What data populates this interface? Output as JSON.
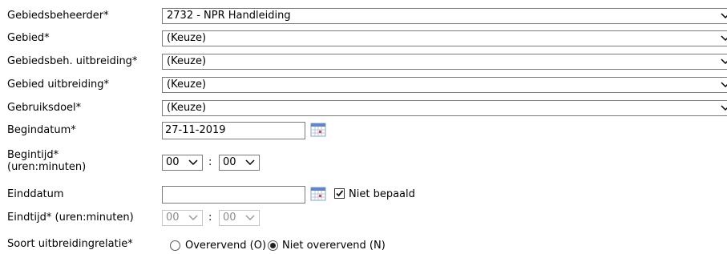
{
  "form": {
    "gebiedsbeheerder": {
      "label": "Gebiedsbeheerder*",
      "value": "2732 - NPR Handleiding"
    },
    "gebied": {
      "label": "Gebied*",
      "value": "(Keuze)"
    },
    "gebiedsbeh_uitbreiding": {
      "label": "Gebiedsbeh. uitbreiding*",
      "value": "(Keuze)"
    },
    "gebied_uitbreiding": {
      "label": "Gebied uitbreiding*",
      "value": "(Keuze)"
    },
    "gebruiksdoel": {
      "label": "Gebruiksdoel*",
      "value": "(Keuze)"
    },
    "begindatum": {
      "label": "Begindatum*",
      "value": "27-11-2019"
    },
    "begintijd": {
      "label_line1": "Begintijd*",
      "label_line2": "(uren:minuten)",
      "hours": "00",
      "minutes": "00",
      "separator": ":"
    },
    "einddatum": {
      "label": "Einddatum",
      "value": "",
      "niet_bepaald_label": "Niet bepaald",
      "niet_bepaald_checked": true
    },
    "eindtijd": {
      "label": "Eindtijd* (uren:minuten)",
      "hours": "00",
      "minutes": "00",
      "separator": ":",
      "disabled": true
    },
    "soort_uitbreidingrelatie": {
      "label": "Soort uitbreidingrelatie*",
      "options": [
        {
          "label": "Overervend (O)",
          "selected": false
        },
        {
          "label": "Niet overervend (N)",
          "selected": true
        }
      ]
    }
  }
}
